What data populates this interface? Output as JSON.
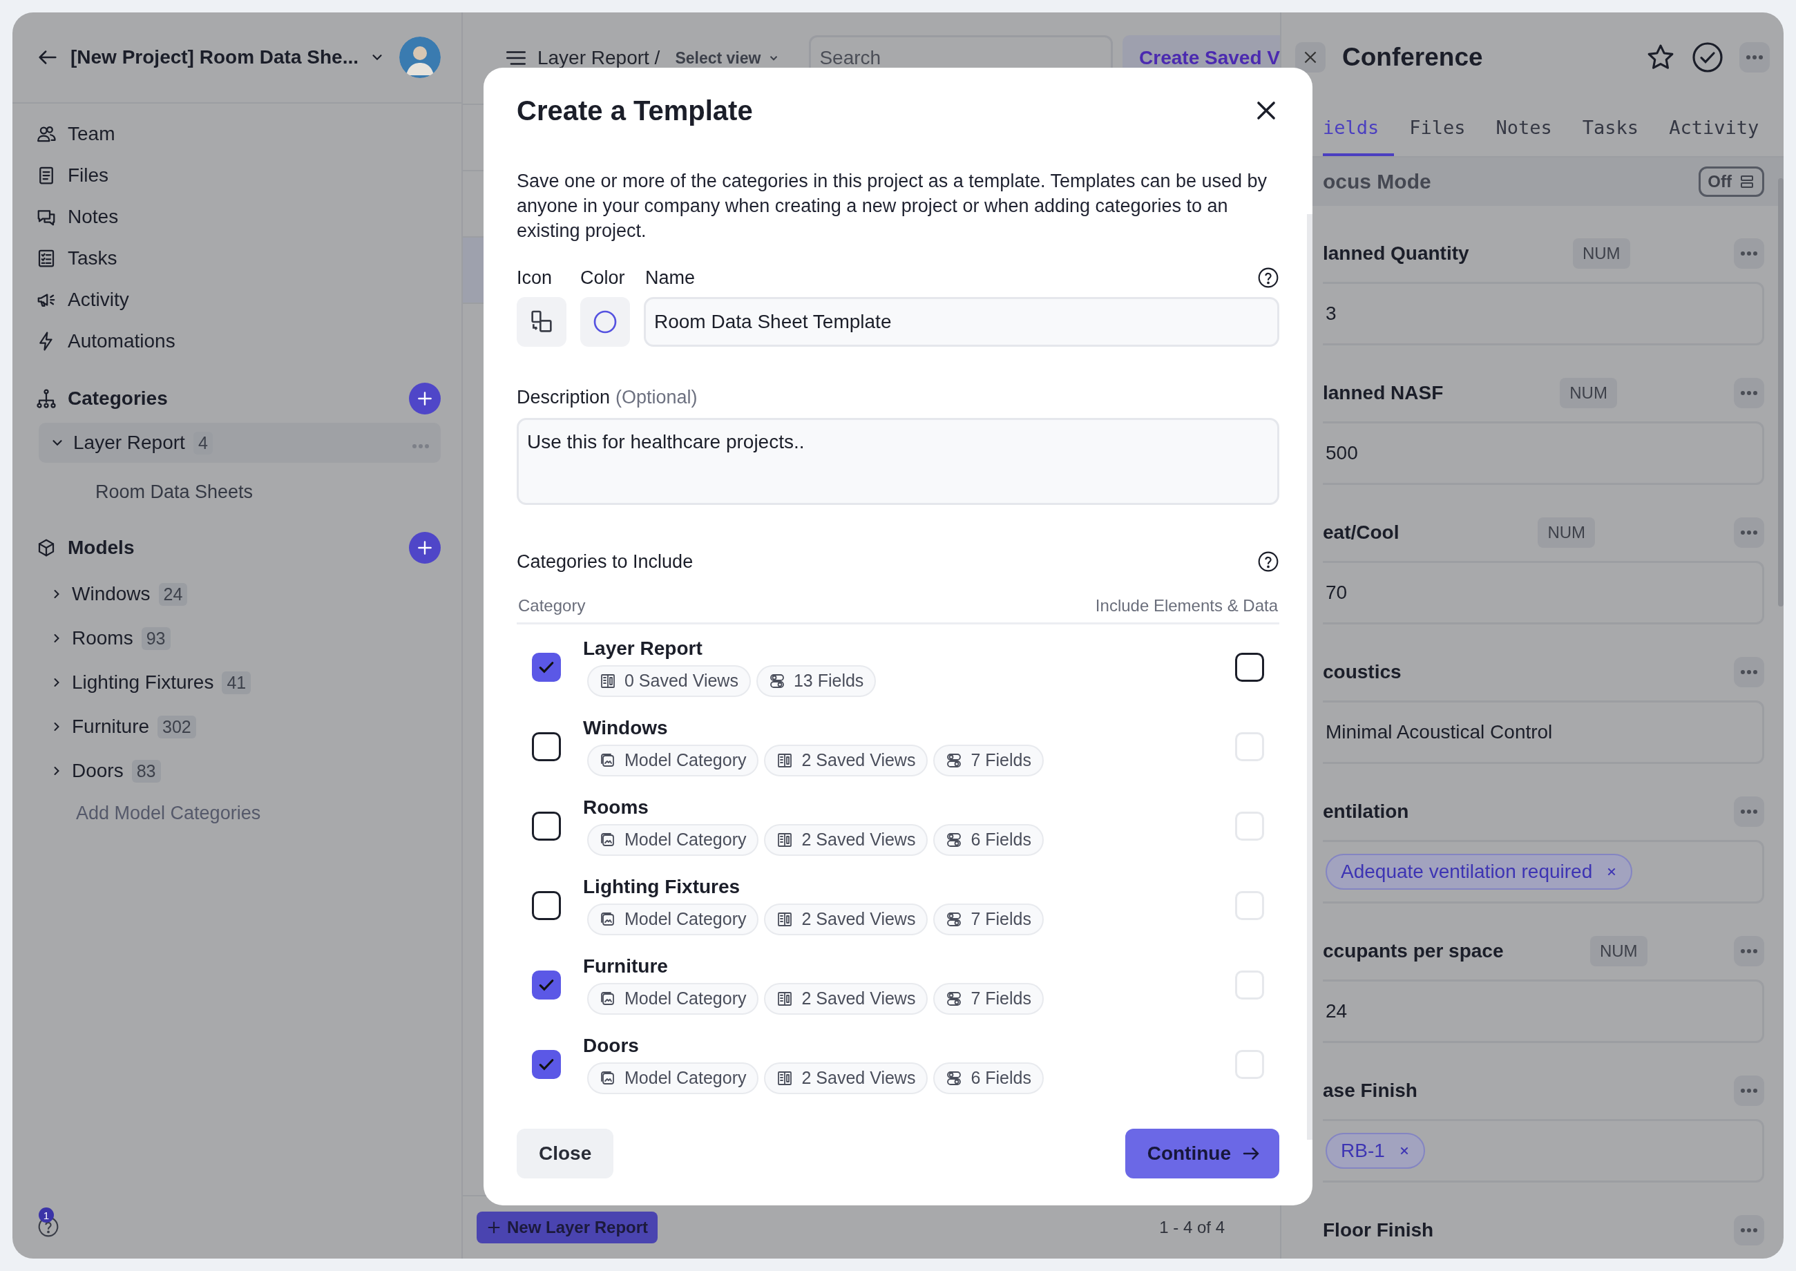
{
  "sidebar": {
    "project_title": "[New Project] Room Data She...",
    "nav": [
      {
        "label": "Team"
      },
      {
        "label": "Files"
      },
      {
        "label": "Notes"
      },
      {
        "label": "Tasks"
      },
      {
        "label": "Activity"
      },
      {
        "label": "Automations"
      }
    ],
    "categories": {
      "title": "Categories",
      "items": [
        {
          "label": "Layer Report",
          "count": "4",
          "selected": true,
          "expanded": true,
          "children": [
            {
              "label": "Room Data Sheets"
            }
          ]
        }
      ]
    },
    "models": {
      "title": "Models",
      "items": [
        {
          "label": "Windows",
          "count": "24",
          "selected": false,
          "expanded": false
        },
        {
          "label": "Rooms",
          "count": "93",
          "selected": false,
          "expanded": false
        },
        {
          "label": "Lighting Fixtures",
          "count": "41",
          "selected": false,
          "expanded": false
        },
        {
          "label": "Furniture",
          "count": "302",
          "selected": false,
          "expanded": false
        },
        {
          "label": "Doors",
          "count": "83",
          "selected": false,
          "expanded": false
        }
      ],
      "add_link": "Add Model Categories"
    },
    "help_badge": "1"
  },
  "main": {
    "breadcrumb": "Layer Report /",
    "view_select": "Select view",
    "search": {
      "placeholder": "Search"
    },
    "create_button": "Create Saved V",
    "new_button": "New Layer Report",
    "pagination": "1 - 4 of 4"
  },
  "panel": {
    "title": "Conference",
    "tabs": [
      {
        "label": "ields",
        "selected": true
      },
      {
        "label": "Files",
        "selected": false
      },
      {
        "label": "Notes",
        "selected": false
      },
      {
        "label": "Tasks",
        "selected": false
      },
      {
        "label": "Activity",
        "selected": false
      }
    ],
    "focus_mode": {
      "label": "ocus Mode",
      "toggle": "Off",
      "on": false
    },
    "fields": [
      {
        "label": "lanned Quantity",
        "badge": "NUM",
        "kind": "text",
        "value": "3"
      },
      {
        "label": "lanned NASF",
        "badge": "NUM",
        "kind": "text",
        "value": "500"
      },
      {
        "label": "eat/Cool",
        "badge": "NUM",
        "kind": "text",
        "value": "70"
      },
      {
        "label": "coustics",
        "kind": "text",
        "value": "Minimal Acoustical Control"
      },
      {
        "label": "entilation",
        "kind": "tags",
        "tags": [
          "Adequate ventilation required"
        ]
      },
      {
        "label": "ccupants per space",
        "badge": "NUM",
        "kind": "text",
        "value": "24"
      },
      {
        "label": "ase Finish",
        "kind": "tags",
        "tags": [
          "RB-1"
        ]
      },
      {
        "label": "Floor Finish",
        "kind": "cut"
      }
    ]
  },
  "modal": {
    "title": "Create a Template",
    "intro": "Save one or more of the categories in this project as a template. Templates can be used by anyone in your company when creating a new project or when adding categories to an existing project.",
    "icon_label": "Icon",
    "color_label": "Color",
    "name_label": "Name",
    "name_value": "Room Data Sheet Template",
    "description_label": "Description",
    "description_optional": "(Optional)",
    "description_value": "Use this for healthcare projects..",
    "categories_title": "Categories to Include",
    "columns": [
      "Category",
      "Include Elements & Data"
    ],
    "categories": [
      {
        "name": "Layer Report",
        "checked": true,
        "include_data": false,
        "disabled": false,
        "chips": [
          {
            "kind": "views",
            "label": "0 Saved Views"
          },
          {
            "kind": "fields",
            "label": "13 Fields"
          }
        ]
      },
      {
        "name": "Windows",
        "checked": false,
        "include_data": false,
        "disabled": true,
        "chips": [
          {
            "kind": "model",
            "label": "Model Category"
          },
          {
            "kind": "views",
            "label": "2 Saved Views"
          },
          {
            "kind": "fields",
            "label": "7 Fields"
          }
        ]
      },
      {
        "name": "Rooms",
        "checked": false,
        "include_data": false,
        "disabled": true,
        "chips": [
          {
            "kind": "model",
            "label": "Model Category"
          },
          {
            "kind": "views",
            "label": "2 Saved Views"
          },
          {
            "kind": "fields",
            "label": "6 Fields"
          }
        ]
      },
      {
        "name": "Lighting Fixtures",
        "checked": false,
        "include_data": false,
        "disabled": true,
        "chips": [
          {
            "kind": "model",
            "label": "Model Category"
          },
          {
            "kind": "views",
            "label": "2 Saved Views"
          },
          {
            "kind": "fields",
            "label": "7 Fields"
          }
        ]
      },
      {
        "name": "Furniture",
        "checked": true,
        "include_data": false,
        "disabled": true,
        "chips": [
          {
            "kind": "model",
            "label": "Model Category"
          },
          {
            "kind": "views",
            "label": "2 Saved Views"
          },
          {
            "kind": "fields",
            "label": "7 Fields"
          }
        ]
      },
      {
        "name": "Doors",
        "checked": true,
        "include_data": false,
        "disabled": true,
        "chips": [
          {
            "kind": "model",
            "label": "Model Category"
          },
          {
            "kind": "views",
            "label": "2 Saved Views"
          },
          {
            "kind": "fields",
            "label": "6 Fields"
          }
        ]
      }
    ],
    "close_button": "Close",
    "continue_button": "Continue"
  }
}
